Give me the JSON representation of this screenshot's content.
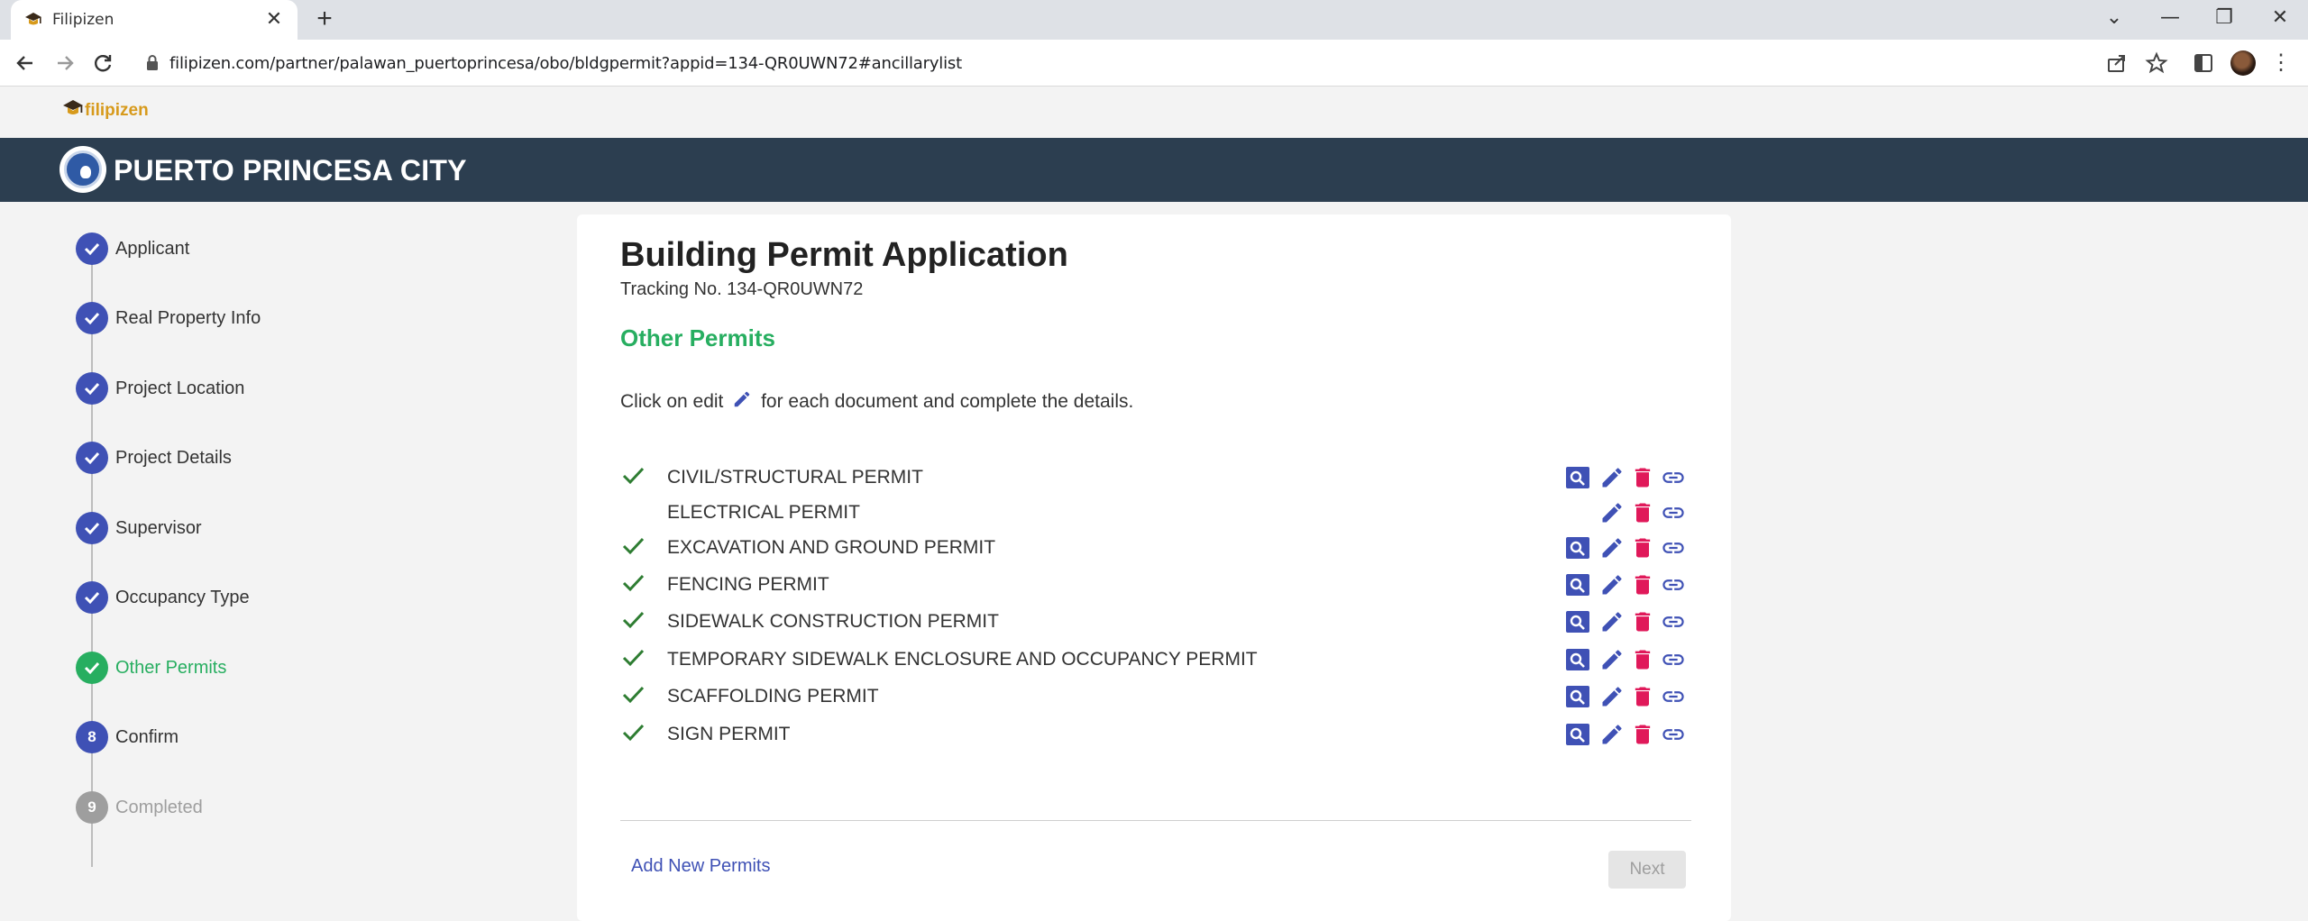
{
  "browser": {
    "tab_title": "Filipizen",
    "tab_close": "✕",
    "new_tab": "+",
    "url": "filipizen.com/partner/palawan_puertoprincesa/obo/bldgpermit?appid=134-QR0UWN72#ancillarylist",
    "window_controls": [
      "⌄",
      "—",
      "❐",
      "✕"
    ]
  },
  "brand": {
    "name": "filipizen"
  },
  "header": {
    "city": "PUERTO PRINCESA CITY"
  },
  "steps": [
    {
      "label": "Applicant",
      "state": "done"
    },
    {
      "label": "Real Property Info",
      "state": "done"
    },
    {
      "label": "Project Location",
      "state": "done"
    },
    {
      "label": "Project Details",
      "state": "done"
    },
    {
      "label": "Supervisor",
      "state": "done"
    },
    {
      "label": "Occupancy Type",
      "state": "done"
    },
    {
      "label": "Other Permits",
      "state": "active"
    },
    {
      "label": "Confirm",
      "state": "pending",
      "number": "8"
    },
    {
      "label": "Completed",
      "state": "disabled",
      "number": "9"
    }
  ],
  "card": {
    "title": "Building Permit Application",
    "tracking": "Tracking No. 134-QR0UWN72",
    "section": "Other Permits",
    "instruction_before": "Click on edit",
    "instruction_after": "for each document and complete the details.",
    "permits": [
      {
        "name": "CIVIL/STRUCTURAL PERMIT",
        "checked": true,
        "viewable": true
      },
      {
        "name": "ELECTRICAL PERMIT",
        "checked": false,
        "viewable": false
      },
      {
        "name": "EXCAVATION AND GROUND PERMIT",
        "checked": true,
        "viewable": true
      },
      {
        "name": "FENCING PERMIT",
        "checked": true,
        "viewable": true
      },
      {
        "name": "SIDEWALK CONSTRUCTION PERMIT",
        "checked": true,
        "viewable": true
      },
      {
        "name": "TEMPORARY SIDEWALK ENCLOSURE AND OCCUPANCY PERMIT",
        "checked": true,
        "viewable": true
      },
      {
        "name": "SCAFFOLDING PERMIT",
        "checked": true,
        "viewable": true
      },
      {
        "name": "SIGN PERMIT",
        "checked": true,
        "viewable": true
      }
    ],
    "add_link": "Add New Permits",
    "next_button": "Next"
  },
  "colors": {
    "header_bg": "#2c3e50",
    "step_blue": "#3f51b5",
    "active_green": "#27ae60",
    "delete_red": "#e0195a",
    "brand_gold": "#d79a1c"
  }
}
